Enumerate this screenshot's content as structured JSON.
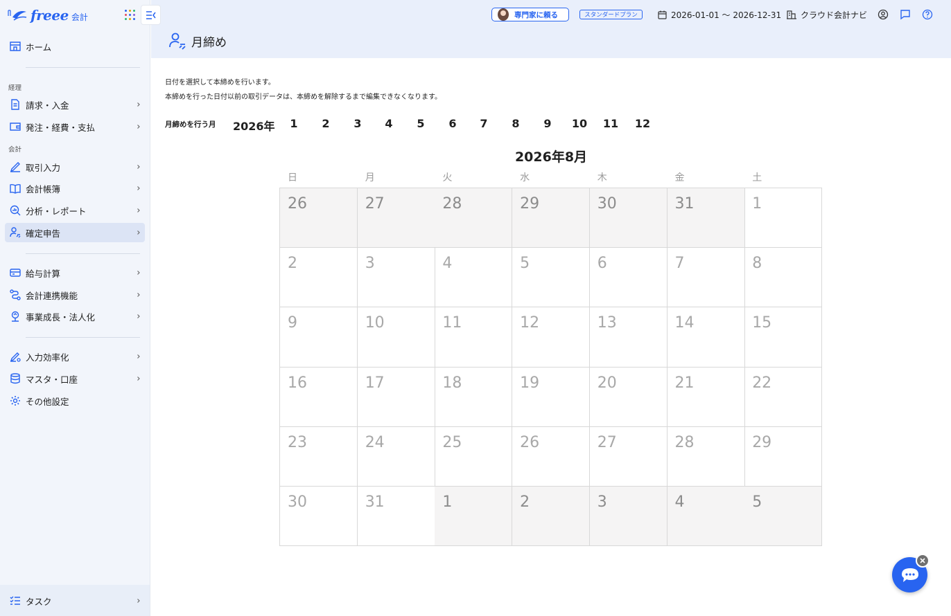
{
  "app": {
    "logo_text": "freee",
    "logo_sub": "会計"
  },
  "sidebar": {
    "home": "ホーム",
    "sections": {
      "keiri": "経理",
      "kaikei": "会計"
    },
    "items": [
      {
        "label": "請求・入金",
        "icon": "document-icon"
      },
      {
        "label": "発注・経費・支払",
        "icon": "wallet-icon"
      },
      {
        "label": "取引入力",
        "icon": "pen-icon"
      },
      {
        "label": "会計帳簿",
        "icon": "book-icon"
      },
      {
        "label": "分析・レポート",
        "icon": "chart-search-icon"
      },
      {
        "label": "確定申告",
        "icon": "person-check-icon"
      },
      {
        "label": "給与計算",
        "icon": "card-icon"
      },
      {
        "label": "会計連携機能",
        "icon": "link-icon"
      },
      {
        "label": "事業成長・法人化",
        "icon": "growth-icon"
      },
      {
        "label": "入力効率化",
        "icon": "pen-gear-icon"
      },
      {
        "label": "マスタ・口座",
        "icon": "database-icon"
      },
      {
        "label": "その他設定",
        "icon": "gear-icon"
      }
    ],
    "task": "タスク"
  },
  "header": {
    "expert_button": "専門家に頼る",
    "plan_badge": "スタンダードプラン",
    "period": "2026-01-01 〜 2026-12-31",
    "navi": "クラウド会計ナビ",
    "page_title": "月締め"
  },
  "main": {
    "desc1": "日付を選択して本締めを行います。",
    "desc2": "本締めを行った日付以前の取引データは、本締めを解除するまで編集できなくなります。",
    "month_label": "月締めを行う月",
    "year": "2026年",
    "months": [
      "1",
      "2",
      "3",
      "4",
      "5",
      "6",
      "7",
      "8",
      "9",
      "10",
      "11",
      "12"
    ]
  },
  "calendar": {
    "title": "2026年8月",
    "weekdays": [
      "日",
      "月",
      "火",
      "水",
      "木",
      "金",
      "土"
    ],
    "weeks": [
      [
        {
          "d": "26",
          "out": true
        },
        {
          "d": "27",
          "out": true
        },
        {
          "d": "28",
          "out": true
        },
        {
          "d": "29",
          "out": true
        },
        {
          "d": "30",
          "out": true
        },
        {
          "d": "31",
          "out": true
        },
        {
          "d": "1",
          "out": false
        }
      ],
      [
        {
          "d": "2",
          "out": false
        },
        {
          "d": "3",
          "out": false
        },
        {
          "d": "4",
          "out": false
        },
        {
          "d": "5",
          "out": false
        },
        {
          "d": "6",
          "out": false
        },
        {
          "d": "7",
          "out": false
        },
        {
          "d": "8",
          "out": false
        }
      ],
      [
        {
          "d": "9",
          "out": false
        },
        {
          "d": "10",
          "out": false
        },
        {
          "d": "11",
          "out": false
        },
        {
          "d": "12",
          "out": false
        },
        {
          "d": "13",
          "out": false
        },
        {
          "d": "14",
          "out": false
        },
        {
          "d": "15",
          "out": false
        }
      ],
      [
        {
          "d": "16",
          "out": false
        },
        {
          "d": "17",
          "out": false
        },
        {
          "d": "18",
          "out": false
        },
        {
          "d": "19",
          "out": false
        },
        {
          "d": "20",
          "out": false
        },
        {
          "d": "21",
          "out": false
        },
        {
          "d": "22",
          "out": false
        }
      ],
      [
        {
          "d": "23",
          "out": false
        },
        {
          "d": "24",
          "out": false
        },
        {
          "d": "25",
          "out": false
        },
        {
          "d": "26",
          "out": false
        },
        {
          "d": "27",
          "out": false
        },
        {
          "d": "28",
          "out": false
        },
        {
          "d": "29",
          "out": false
        }
      ],
      [
        {
          "d": "30",
          "out": false
        },
        {
          "d": "31",
          "out": false
        },
        {
          "d": "1",
          "out": true
        },
        {
          "d": "2",
          "out": true
        },
        {
          "d": "3",
          "out": true
        },
        {
          "d": "4",
          "out": true
        },
        {
          "d": "5",
          "out": true
        }
      ]
    ]
  },
  "colors": {
    "brand": "#2864f0",
    "sidebar_bg": "#f2f5fb",
    "header_bg": "#e9effb",
    "active_bg": "#dce4f5"
  }
}
